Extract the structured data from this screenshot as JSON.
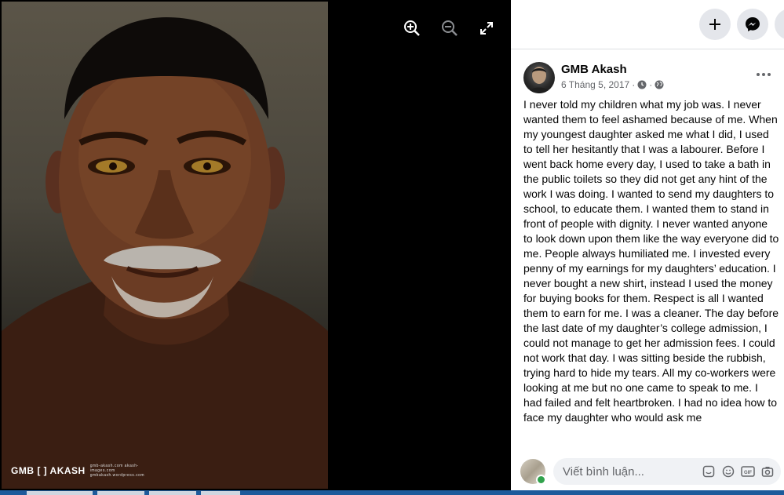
{
  "viewer": {
    "watermark": "GMB [ ] AKASH",
    "watermark_small": "gmb-akash.com akash-images.com gmbakash.wordpress.com",
    "controls": [
      "zoom-in",
      "zoom-out",
      "fullscreen"
    ]
  },
  "topbar": {
    "buttons": [
      "plus-icon",
      "messenger-icon",
      "menu-icon"
    ]
  },
  "post": {
    "author": "GMB Akash",
    "date": "6 Tháng 5, 2017",
    "separator": "·",
    "text": "I never told my children what my job was. I never wanted them to feel ashamed because of me. When my youngest daughter asked me what I did, I used to tell her hesitantly that I was a labourer. Before I went back home every day, I used to take a bath in the public toilets so they did not get any hint of the work I was doing. I wanted to send my daughters to school, to educate them. I wanted them to stand in front of people with dignity. I never wanted anyone to look down upon them like the way everyone did to me. People always humiliated me. I invested every penny of my earnings for my daughters’ education. I never bought a new shirt, instead I used the money for buying books for them. Respect is all I wanted them to earn for me. I was a cleaner. The day before the last date of my daughter’s college admission, I could not manage to get her admission fees. I could not work that day. I was sitting beside the rubbish, trying hard to hide my tears. All my co-workers were looking at me but no one came to speak to me. I had failed and felt heartbroken. I had no idea how to face my daughter who would ask me"
  },
  "comment": {
    "placeholder": "Viết bình luận...",
    "icons": [
      "sticker-icon",
      "emoji-icon",
      "gif-icon",
      "camera-icon"
    ]
  },
  "colors": {
    "panel_bg": "#ffffff",
    "button_bg": "#e4e6eb",
    "secondary_text": "#65676b",
    "input_bg": "#f0f2f5"
  }
}
